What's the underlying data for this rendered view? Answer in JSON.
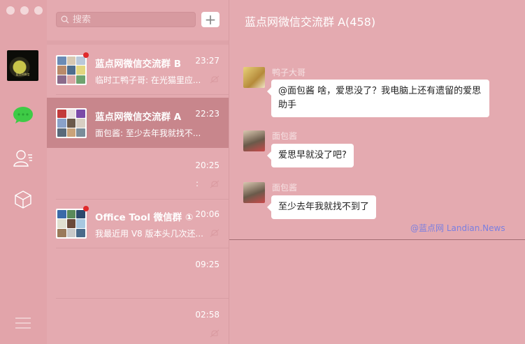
{
  "search": {
    "placeholder": "搜索"
  },
  "add_button": {
    "label": "+"
  },
  "self": {
    "avatar_caption": "蓝点网微信"
  },
  "conversations": [
    {
      "name": "蓝点网微信交流群 B",
      "time": "23:27",
      "preview": "临时工鸭子哥: 在光猫里应...",
      "unread": true,
      "selected": false
    },
    {
      "name": "蓝点网微信交流群 A",
      "time": "22:23",
      "preview": "面包酱: 至少去年我就找不...",
      "unread": false,
      "selected": true
    },
    {
      "name": "",
      "time": "20:25",
      "preview": ":",
      "unread": false,
      "selected": false
    },
    {
      "name": "Office Tool 微信群 ①",
      "time": "20:06",
      "preview": "我最近用 V8 版本头几次还...",
      "unread": true,
      "selected": false
    },
    {
      "name": "",
      "time": "09:25",
      "preview": "",
      "unread": false,
      "selected": false
    },
    {
      "name": "",
      "time": "02:58",
      "preview": "",
      "unread": false,
      "selected": false
    }
  ],
  "chat": {
    "title": "蓝点网微信交流群 A(458)",
    "messages": [
      {
        "author": "鸭子大哥",
        "text_line1": "@面包酱 啥，爱思没了？我电脑上还有遗留的爱思",
        "text_line2": "助手"
      },
      {
        "author": "面包酱",
        "text": "爱思早就没了吧?"
      },
      {
        "author": "面包酱",
        "text": "至少去年我就找不到了"
      }
    ],
    "watermark": "@蓝点网 Landian.News"
  },
  "colors": {
    "background": "#e4aab0",
    "selected_row": "#c8868c",
    "unread_dot": "#e0292b",
    "wechat_green": "#3ecb46"
  }
}
